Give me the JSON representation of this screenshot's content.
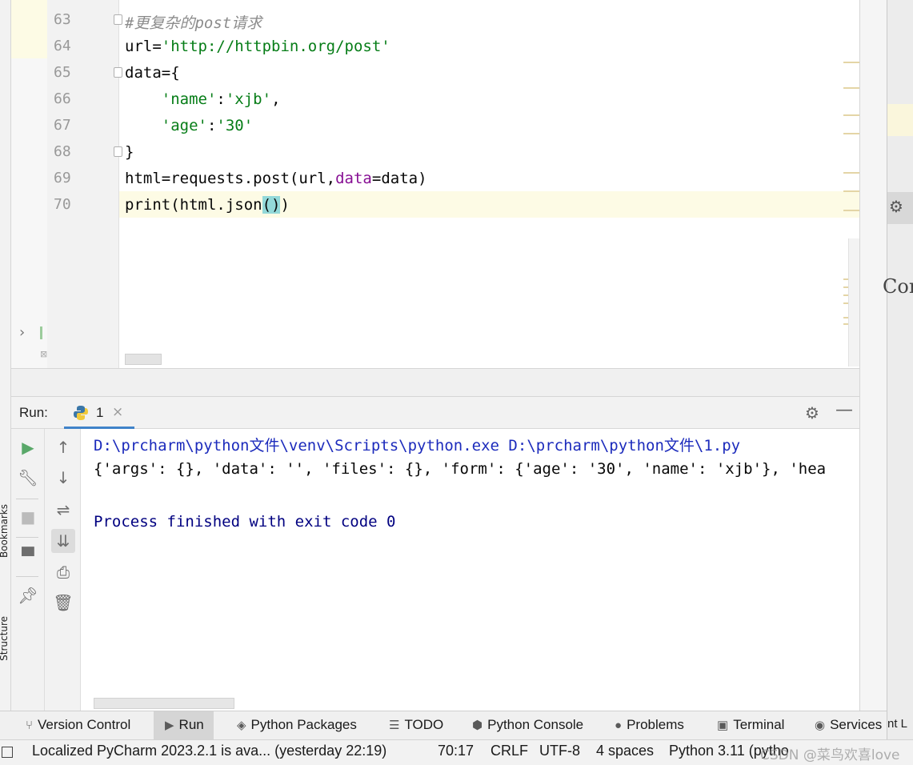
{
  "editor": {
    "lines": [
      {
        "num": "63",
        "comment": "#更复杂的post请求"
      },
      {
        "num": "64",
        "var": "url=",
        "str": "'http://httpbin.org/post'"
      },
      {
        "num": "65",
        "text": "data={"
      },
      {
        "num": "66",
        "str": "'name'",
        "mid": ":",
        "str2": "'xjb'",
        "tail": ","
      },
      {
        "num": "67",
        "str": "'age'",
        "mid": ":",
        "str2": "'30'"
      },
      {
        "num": "68",
        "text": "}"
      },
      {
        "num": "69",
        "pre": "html=requests.post(url,",
        "kw": "data",
        "post": "=data)"
      },
      {
        "num": "70",
        "pre": "print(html.json",
        "paren": "()",
        "post": ")"
      }
    ]
  },
  "left_strip": {
    "bookmarks_label": "Bookmarks",
    "structure_label": "Structure"
  },
  "run_panel": {
    "title": "Run:",
    "tab_label": "1",
    "close_glyph": "×",
    "console": {
      "command": "D:\\prcharm\\python文件\\venv\\Scripts\\python.exe D:\\prcharm\\python文件\\1.py",
      "output": "{'args': {}, 'data': '', 'files': {}, 'form': {'age': '30', 'name': 'xjb'}, 'hea",
      "exit_message": "Process finished with exit code 0"
    },
    "colors": {
      "command": "#1c2bbc",
      "output": "#080808",
      "exit": "#000080"
    }
  },
  "tool_windows": [
    {
      "label": "Version Control",
      "icon": "branch-icon"
    },
    {
      "label": "Run",
      "icon": "play-icon",
      "active": true
    },
    {
      "label": "Python Packages",
      "icon": "layers-icon"
    },
    {
      "label": "TODO",
      "icon": "list-icon"
    },
    {
      "label": "Python Console",
      "icon": "python-icon"
    },
    {
      "label": "Problems",
      "icon": "info-icon"
    },
    {
      "label": "Terminal",
      "icon": "terminal-icon"
    },
    {
      "label": "Services",
      "icon": "services-icon"
    }
  ],
  "status_bar": {
    "notification": "Localized PyCharm 2023.2.1 is ava... (yesterday 22:19)",
    "position": "70:17",
    "line_sep": "CRLF",
    "encoding": "UTF-8",
    "indent": "4 spaces",
    "interpreter": "Python 3.11 (pytho",
    "watermark": "CSDN @菜鸟欢喜love"
  },
  "right_edge": {
    "partial_text": "Con",
    "partial_bottom": "nt L"
  }
}
